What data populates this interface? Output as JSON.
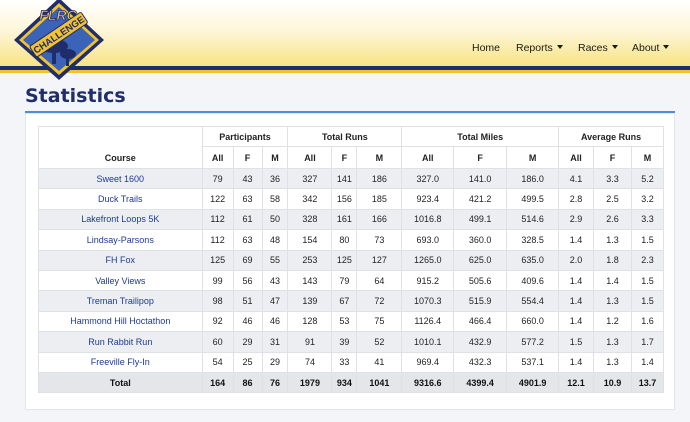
{
  "logo": {
    "line1": "FLRC",
    "line2": "CHALLENGE"
  },
  "nav": {
    "home": "Home",
    "reports": "Reports",
    "races": "Races",
    "about": "About"
  },
  "page": {
    "title": "Statistics"
  },
  "table": {
    "groups": {
      "course": "Course",
      "participants": "Participants",
      "total_runs": "Total Runs",
      "total_miles": "Total Miles",
      "average_runs": "Average Runs"
    },
    "sub": {
      "all": "All",
      "f": "F",
      "m": "M"
    },
    "rows": [
      [
        "Sweet 1600",
        "79",
        "43",
        "36",
        "327",
        "141",
        "186",
        "327.0",
        "141.0",
        "186.0",
        "4.1",
        "3.3",
        "5.2"
      ],
      [
        "Duck Trails",
        "122",
        "63",
        "58",
        "342",
        "156",
        "185",
        "923.4",
        "421.2",
        "499.5",
        "2.8",
        "2.5",
        "3.2"
      ],
      [
        "Lakefront Loops 5K",
        "112",
        "61",
        "50",
        "328",
        "161",
        "166",
        "1016.8",
        "499.1",
        "514.6",
        "2.9",
        "2.6",
        "3.3"
      ],
      [
        "Lindsay-Parsons",
        "112",
        "63",
        "48",
        "154",
        "80",
        "73",
        "693.0",
        "360.0",
        "328.5",
        "1.4",
        "1.3",
        "1.5"
      ],
      [
        "FH Fox",
        "125",
        "69",
        "55",
        "253",
        "125",
        "127",
        "1265.0",
        "625.0",
        "635.0",
        "2.0",
        "1.8",
        "2.3"
      ],
      [
        "Valley Views",
        "99",
        "56",
        "43",
        "143",
        "79",
        "64",
        "915.2",
        "505.6",
        "409.6",
        "1.4",
        "1.4",
        "1.5"
      ],
      [
        "Treman Trailipop",
        "98",
        "51",
        "47",
        "139",
        "67",
        "72",
        "1070.3",
        "515.9",
        "554.4",
        "1.4",
        "1.3",
        "1.5"
      ],
      [
        "Hammond Hill Hoctathon",
        "92",
        "46",
        "46",
        "128",
        "53",
        "75",
        "1126.4",
        "466.4",
        "660.0",
        "1.4",
        "1.2",
        "1.6"
      ],
      [
        "Run Rabbit Run",
        "60",
        "29",
        "31",
        "91",
        "39",
        "52",
        "1010.1",
        "432.9",
        "577.2",
        "1.5",
        "1.3",
        "1.7"
      ],
      [
        "Freeville Fly-In",
        "54",
        "25",
        "29",
        "74",
        "33",
        "41",
        "969.4",
        "432.3",
        "537.1",
        "1.4",
        "1.3",
        "1.4"
      ]
    ],
    "total": [
      "Total",
      "164",
      "86",
      "76",
      "1979",
      "934",
      "1041",
      "9316.6",
      "4399.4",
      "4901.9",
      "12.1",
      "10.9",
      "13.7"
    ]
  }
}
